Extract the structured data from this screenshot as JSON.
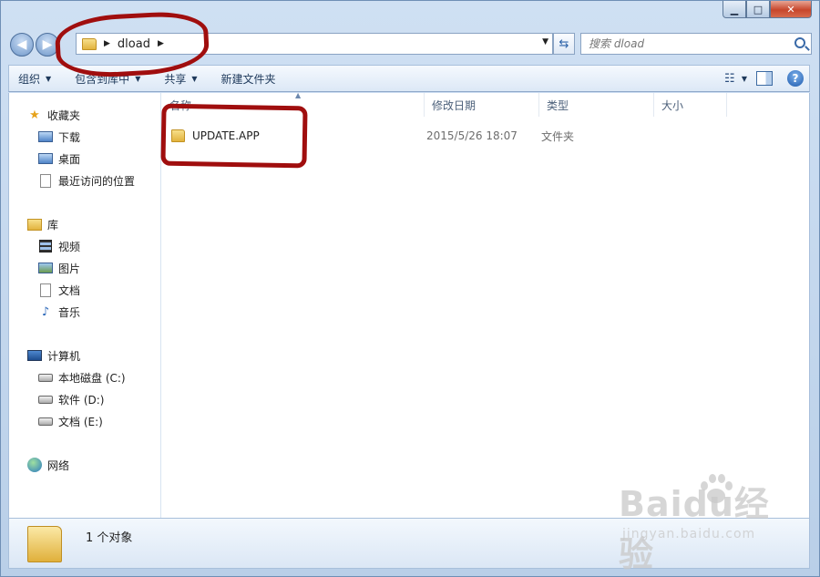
{
  "window": {
    "caption": {
      "minimize": "▁",
      "maximize": "□",
      "close": "✕"
    }
  },
  "address": {
    "crumbs": [
      "dload"
    ],
    "search_placeholder": "搜索 dload"
  },
  "toolbar": {
    "organize": "组织",
    "include_library": "包含到库中",
    "share": "共享",
    "new_folder": "新建文件夹"
  },
  "sidebar": {
    "favorites": {
      "label": "收藏夹",
      "items": [
        "下载",
        "桌面",
        "最近访问的位置"
      ]
    },
    "libraries": {
      "label": "库",
      "items": [
        "视频",
        "图片",
        "文档",
        "音乐"
      ]
    },
    "computer": {
      "label": "计算机",
      "items": [
        "本地磁盘 (C:)",
        "软件 (D:)",
        "文档 (E:)"
      ]
    },
    "network": {
      "label": "网络"
    }
  },
  "columns": [
    "名称",
    "修改日期",
    "类型",
    "大小"
  ],
  "files": [
    {
      "name": "UPDATE.APP",
      "date": "2015/5/26 18:07",
      "type": "文件夹",
      "size": ""
    }
  ],
  "details": {
    "count": "1 个对象"
  },
  "watermark": {
    "brand": "Baidu经验",
    "url": "jingyan.baidu.com"
  }
}
